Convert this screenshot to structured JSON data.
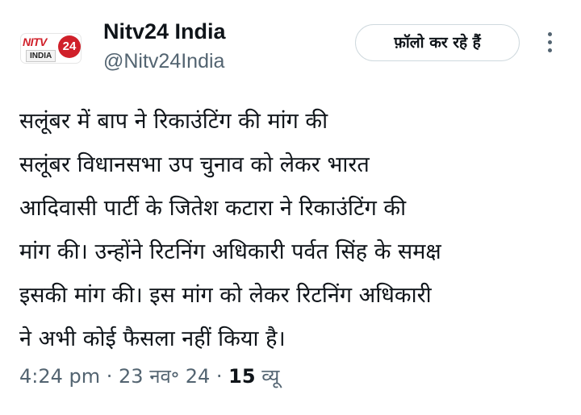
{
  "account": {
    "logo_text": "NITV",
    "logo_number": "24",
    "logo_subtext": "INDIA",
    "name": "Nitv24 India",
    "handle": "@Nitv24India"
  },
  "follow_button": {
    "label": "फ़ॉलो कर रहे हैं"
  },
  "tweet": {
    "lines": [
      "सलूंबर में बाप ने रिकाउंटिंग की मांग की",
      "सलूंबर विधानसभा उप चुनाव को लेकर भारत",
      "आदिवासी पार्टी के जितेश कटारा ने रिकाउंटिंग की",
      "मांग की। उन्होंने रिटनिंग अधिकारी पर्वत सिंह के समक्ष",
      "इसकी मांग की। इस मांग को लेकर रिटनिंग अधिकारी",
      "ने अभी कोई फैसला नहीं किया है।"
    ]
  },
  "meta": {
    "time": "4:24 pm",
    "separator": " · ",
    "date": "23 नव॰ 24",
    "views_count": "15",
    "views_label": " व्यू"
  },
  "colors": {
    "text": "#0f1419",
    "secondary": "#536471",
    "border": "#cfd9de",
    "brand_red": "#d0202a"
  }
}
